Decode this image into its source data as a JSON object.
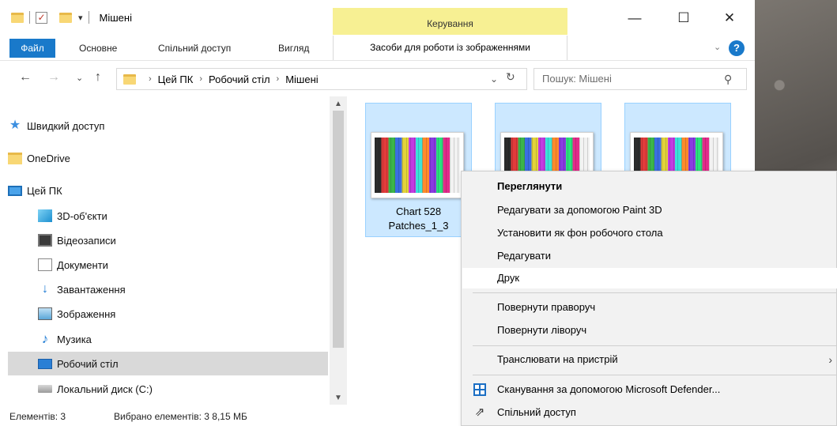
{
  "window": {
    "title": "Мішені",
    "manage_label": "Керування",
    "minimize_glyph": "—",
    "maximize_glyph": "☐",
    "close_glyph": "✕"
  },
  "ribbon": {
    "file_tab": "Файл",
    "tabs": [
      "Основне",
      "Спільний доступ",
      "Вигляд"
    ],
    "tools_tab": "Засоби для роботи із зображеннями",
    "help_glyph": "?"
  },
  "address": {
    "crumbs": [
      "Цей ПК",
      "Робочий стіл",
      "Мішені"
    ],
    "search_placeholder": "Пошук: Мішені"
  },
  "nav": {
    "items": [
      {
        "label": "Швидкий доступ",
        "icon": "star-icon"
      },
      {
        "label": "OneDrive",
        "icon": "folder-icon"
      },
      {
        "label": "Цей ПК",
        "icon": "computer-icon"
      },
      {
        "label": "3D-об'єкти",
        "icon": "3d-objects-icon"
      },
      {
        "label": "Відеозаписи",
        "icon": "video-icon"
      },
      {
        "label": "Документи",
        "icon": "documents-icon"
      },
      {
        "label": "Завантаження",
        "icon": "download-icon"
      },
      {
        "label": "Зображення",
        "icon": "pictures-icon"
      },
      {
        "label": "Музика",
        "icon": "music-icon"
      },
      {
        "label": "Робочий стіл",
        "icon": "desktop-icon",
        "selected": true
      },
      {
        "label": "Локальний диск (C:)",
        "icon": "drive-icon"
      }
    ]
  },
  "files": {
    "first_name_line1": "Chart 528",
    "first_name_line2": "Patches_1_3"
  },
  "status": {
    "count": "Елементів: 3",
    "selected": "Вибрано елементів: 3  8,15 МБ"
  },
  "context_menu": {
    "items": [
      "Переглянути",
      "Редагувати за допомогою Paint 3D",
      "Установити як фон робочого стола",
      "Редагувати",
      "Друк",
      "Повернути праворуч",
      "Повернути ліворуч",
      "Транслювати на пристрій",
      "Сканування за допомогою Microsoft Defender...",
      "Спільний доступ"
    ]
  },
  "colors": {
    "accent": "#1979ca",
    "manage_tab": "#f7f093",
    "selection": "#cce8ff"
  }
}
